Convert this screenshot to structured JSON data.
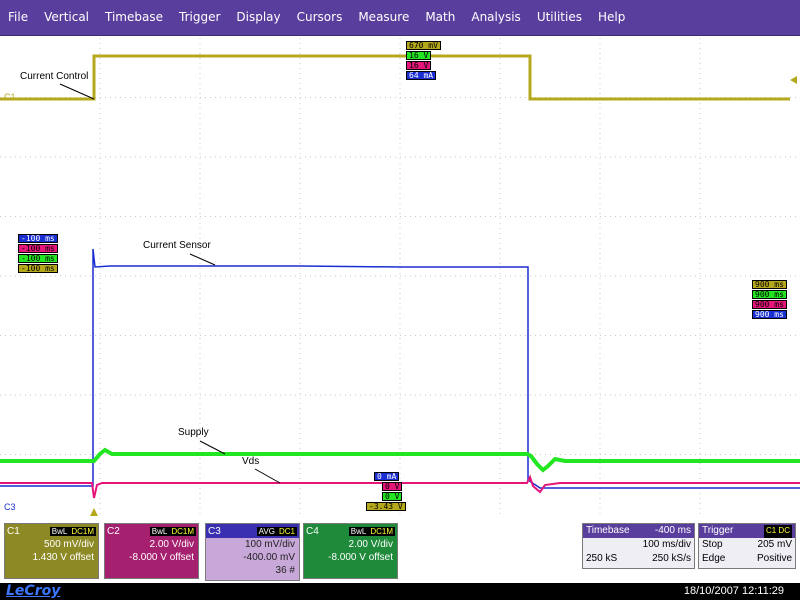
{
  "menu": [
    "File",
    "Vertical",
    "Timebase",
    "Trigger",
    "Display",
    "Cursors",
    "Measure",
    "Math",
    "Analysis",
    "Utilities",
    "Help"
  ],
  "colors": {
    "c1": "#b5a81d",
    "c2": "#e6157a",
    "c3": "#1a2fd1",
    "c4": "#22e622",
    "menu_bg": "#5a3e9d",
    "grid": "#c8c8c8"
  },
  "markers": {
    "c1_left": "C1",
    "c3_left": "C3"
  },
  "trace_labels": {
    "current_control": "Current Control",
    "current_sensor": "Current Sensor",
    "supply": "Supply",
    "vds": "Vds"
  },
  "tags_top": [
    "670 mV",
    "16 V",
    "16 V",
    "64 mA"
  ],
  "tags_left": [
    "-100 ms",
    "-100 ms",
    "-100 ms",
    "-100 ms"
  ],
  "tags_right": [
    "900 ms",
    "900 ms",
    "900 ms",
    "900 ms"
  ],
  "tags_bottom": [
    "0 mA",
    "0 V",
    "0 V",
    "-3.43 V"
  ],
  "channels": {
    "c1": {
      "name": "C1",
      "bwl": "BwL",
      "dc": "DC1M",
      "vdiv": "500 mV/div",
      "offset": "1.430 V offset"
    },
    "c2": {
      "name": "C2",
      "bwl": "BwL",
      "dc": "DC1M",
      "vdiv": "2.00 V/div",
      "offset": "-8.000 V offset"
    },
    "c3": {
      "name": "C3",
      "bwl": "AVG",
      "dc": "DC1",
      "vdiv": "100 mV/div",
      "offset": "-400.00 mV",
      "extra": "36 #"
    },
    "c4": {
      "name": "C4",
      "bwl": "BwL",
      "dc": "DC1M",
      "vdiv": "2.00 V/div",
      "offset": "-8.000 V offset"
    }
  },
  "timebase": {
    "label": "Timebase",
    "delay": "-400 ms",
    "tdiv": "100 ms/div",
    "samples": "250 kS",
    "rate": "250 kS/s"
  },
  "trigger": {
    "label": "Trigger",
    "src": "C1 DC",
    "mode": "Stop",
    "level": "205 mV",
    "type": "Edge",
    "slope": "Positive"
  },
  "logo": "LeCroy",
  "datetime": "18/10/2007 12:11:29"
}
